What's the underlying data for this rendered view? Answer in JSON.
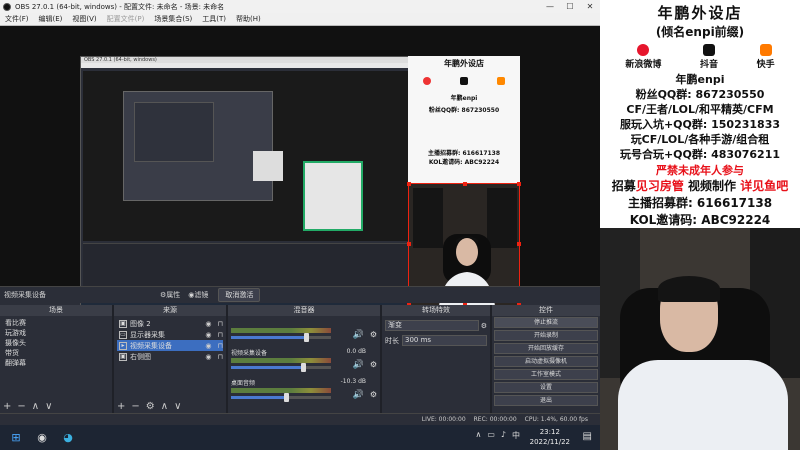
{
  "window": {
    "title": "OBS 27.0.1 (64-bit, windows) - 配置文件: 未命名 - 场景: 未命名"
  },
  "menu": [
    "文件(F)",
    "编辑(E)",
    "视图(V)",
    "配置文件(P)",
    "场景集合(S)",
    "工具(T)",
    "帮助(H)"
  ],
  "selected_source": "视频采集设备",
  "toolbar": {
    "properties": "属性",
    "filters": "滤镜",
    "deactivate": "取消激活"
  },
  "docks": {
    "scenes": {
      "title": "场景",
      "items": [
        "看比赛",
        "玩游戏",
        "摄像头",
        "带货",
        "翻弹幕"
      ],
      "selected": null
    },
    "sources": {
      "title": "来源",
      "items": [
        {
          "name": "图像 2",
          "icon": "image-icon"
        },
        {
          "name": "显示器采集",
          "icon": "monitor-icon"
        },
        {
          "name": "视频采集设备",
          "icon": "camera-icon"
        },
        {
          "name": "右侧图",
          "icon": "image-icon"
        }
      ],
      "selected": 2
    },
    "mixer": {
      "title": "混音器",
      "tracks": [
        {
          "name": "",
          "db": "",
          "level": 0.75
        },
        {
          "name": "视频采集设备",
          "db": "0.0 dB",
          "level": 0.72
        },
        {
          "name": "桌面音频",
          "db": "-10.3 dB",
          "level": 0.55
        }
      ]
    },
    "transitions": {
      "title": "转场特效",
      "type": "渐变",
      "duration_label": "时长",
      "duration": "300 ms"
    },
    "controls": {
      "title": "控件",
      "buttons": [
        "停止推流",
        "开始录制",
        "开始回放缓存",
        "启动虚拟摄像机",
        "工作室模式",
        "设置",
        "退出"
      ]
    }
  },
  "status": {
    "live": "LIVE: 00:00:00",
    "rec": "REC: 00:00:00",
    "cpu": "CPU: 1.4%, 60.00 fps"
  },
  "taskbar": {
    "time": "23:12",
    "date": "2022/11/22",
    "ime": "中"
  },
  "poster": {
    "title": "年鹏外设店",
    "subtitle": "(倾名enpi前缀)",
    "platforms": [
      "新浪微博",
      "抖音",
      "快手"
    ],
    "brand": "年鹏enpi",
    "qq": "粉丝QQ群: 867230550",
    "games": "CF/王者/LOL/和平精英/CFM",
    "group1": "服玩入坑+QQ群: 150231833",
    "games2": "玩CF/LOL/各种手游/组合租",
    "group2": "玩号合玩+QQ群: 483076211",
    "warning": "严禁未成年人参与",
    "recruit_a": "招募",
    "recruit_b": "见习房管",
    "recruit_c": " 视频制作 ",
    "recruit_d": "详见鱼吧",
    "anchor": "主播招募群: 616617138",
    "kol": "KOL邀请码: ABC92224"
  },
  "mini_poster": {
    "title": "年鹏外设店",
    "brand": "年鹏enpi",
    "line": "粉丝QQ群: 867230550",
    "anchor": "主播招募群: 616617138",
    "kol": "KOL邀请码: ABC92224"
  },
  "colors": {
    "accent": "#e8111a",
    "selection": "#3c6ec0",
    "obs_bg": "#2b2e38"
  }
}
